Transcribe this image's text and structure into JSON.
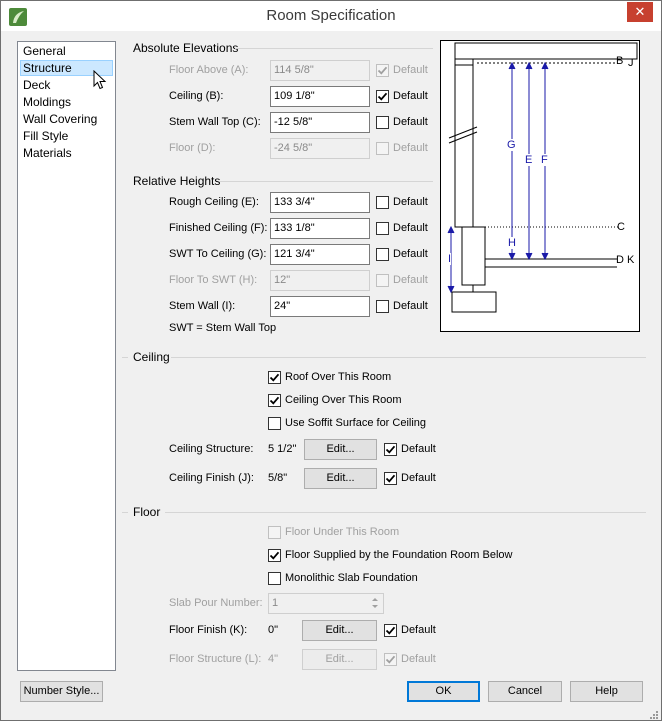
{
  "window": {
    "title": "Room Specification"
  },
  "nav": {
    "items": [
      {
        "label": "General",
        "selected": false
      },
      {
        "label": "Structure",
        "selected": true
      },
      {
        "label": "Deck",
        "selected": false
      },
      {
        "label": "Moldings",
        "selected": false
      },
      {
        "label": "Wall Covering",
        "selected": false
      },
      {
        "label": "Fill Style",
        "selected": false
      },
      {
        "label": "Materials",
        "selected": false
      }
    ]
  },
  "absolute_elevations": {
    "heading": "Absolute Elevations",
    "rows": [
      {
        "label": "Floor Above (A):",
        "value": "114 5/8\"",
        "enabled": false,
        "default_checked": true,
        "default_enabled": false
      },
      {
        "label": "Ceiling (B):",
        "value": "109 1/8\"",
        "enabled": true,
        "default_checked": true,
        "default_enabled": true
      },
      {
        "label": "Stem Wall Top (C):",
        "value": "-12 5/8\"",
        "enabled": true,
        "default_checked": false,
        "default_enabled": true
      },
      {
        "label": "Floor (D):",
        "value": "-24 5/8\"",
        "enabled": false,
        "default_checked": false,
        "default_enabled": false
      }
    ]
  },
  "relative_heights": {
    "heading": "Relative Heights",
    "rows": [
      {
        "label": "Rough Ceiling (E):",
        "value": "133 3/4\"",
        "enabled": true,
        "default_checked": false,
        "default_enabled": true
      },
      {
        "label": "Finished Ceiling (F):",
        "value": "133 1/8\"",
        "enabled": true,
        "default_checked": false,
        "default_enabled": true
      },
      {
        "label": "SWT To Ceiling (G):",
        "value": "121 3/4\"",
        "enabled": true,
        "default_checked": false,
        "default_enabled": true
      },
      {
        "label": "Floor To SWT (H):",
        "value": "12\"",
        "enabled": false,
        "default_checked": false,
        "default_enabled": false
      },
      {
        "label": "Stem Wall (I):",
        "value": "24\"",
        "enabled": true,
        "default_checked": false,
        "default_enabled": true
      }
    ],
    "note": "SWT = Stem Wall Top"
  },
  "default_label": "Default",
  "ceiling": {
    "heading": "Ceiling",
    "checks": [
      {
        "label": "Roof Over This Room",
        "checked": true,
        "enabled": true
      },
      {
        "label": "Ceiling Over This Room",
        "checked": true,
        "enabled": true
      },
      {
        "label": "Use Soffit Surface for Ceiling",
        "checked": false,
        "enabled": true
      }
    ],
    "structure": {
      "label": "Ceiling Structure:",
      "value": "5 1/2\"",
      "button": "Edit...",
      "default_checked": true
    },
    "finish": {
      "label": "Ceiling Finish (J):",
      "value": "5/8\"",
      "button": "Edit...",
      "default_checked": true
    }
  },
  "floor": {
    "heading": "Floor",
    "checks": [
      {
        "label": "Floor Under This Room",
        "checked": false,
        "enabled": false
      },
      {
        "label": "Floor Supplied by the Foundation Room Below",
        "checked": true,
        "enabled": true
      },
      {
        "label": "Monolithic Slab Foundation",
        "checked": false,
        "enabled": true
      }
    ],
    "slab_pour": {
      "label": "Slab Pour Number:",
      "value": "1"
    },
    "finish": {
      "label": "Floor Finish (K):",
      "value": "0\"",
      "button": "Edit...",
      "default_checked": true
    },
    "structure": {
      "label": "Floor Structure (L):",
      "value": "4\"",
      "button": "Edit...",
      "default_checked": true
    }
  },
  "diagram_labels": {
    "b": "B",
    "j": "J",
    "c": "C",
    "d": "D",
    "k": "K",
    "g": "G",
    "e": "E",
    "f": "F",
    "h": "H",
    "i": "I"
  },
  "footer": {
    "number_style": "Number Style...",
    "ok": "OK",
    "cancel": "Cancel",
    "help": "Help"
  },
  "colors": {
    "accent": "#0078d7",
    "close": "#c7402f",
    "nav_selected": "#cce8ff",
    "dimension_lines": "#1a1aa8"
  }
}
